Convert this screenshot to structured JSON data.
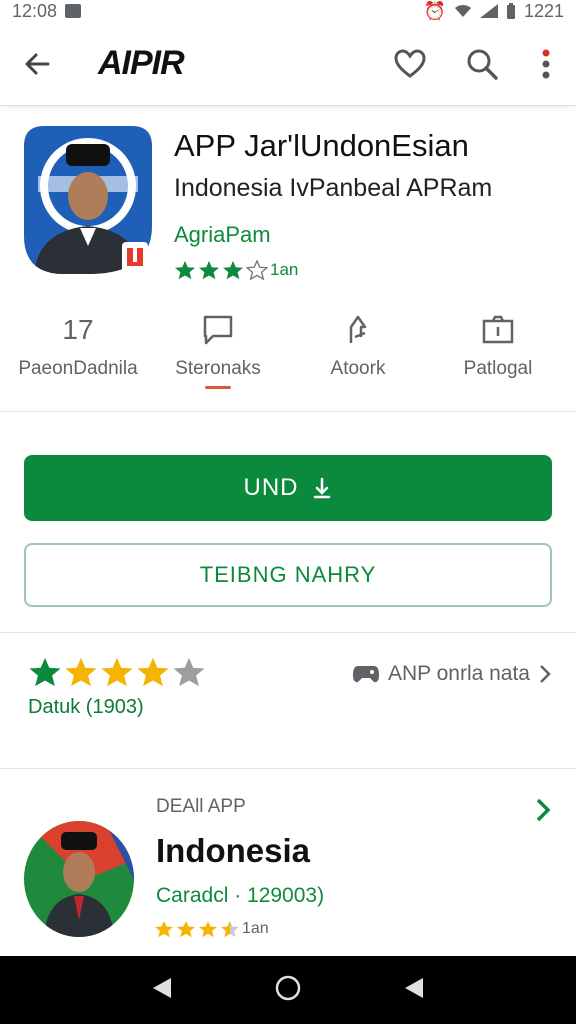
{
  "status_bar": {
    "time": "12:08",
    "battery_text": "1221"
  },
  "topbar": {
    "brand": "AIPIR",
    "back_icon": "arrow-left-icon",
    "actions": [
      "heart-icon",
      "search-icon",
      "more-vert-icon"
    ]
  },
  "app": {
    "title": "APP Jar'lUndonEsian",
    "subtitle": "Indonesia IvPanbeal APRam",
    "developer": "AgriaPam",
    "rating_stars": 3.5,
    "rating_text": "1an",
    "badge_text": "U"
  },
  "stats": [
    {
      "value": "17",
      "icon": "",
      "label": "PaeonDadnila",
      "active": false
    },
    {
      "value": "",
      "icon": "chat-icon",
      "label": "Steronaks",
      "active": true
    },
    {
      "value": "",
      "icon": "share-icon",
      "label": "Atoork",
      "active": false
    },
    {
      "value": "",
      "icon": "info-icon",
      "label": "Patlogal",
      "active": false
    }
  ],
  "buttons": {
    "install": "UND",
    "install_icon": "download-icon",
    "secondary": "TEIBNG NAHRY"
  },
  "rating": {
    "stars": 4,
    "caption": "Datuk (1903)",
    "right_text": "ANP onrla nata",
    "right_icon": "gamepad-icon"
  },
  "related": {
    "kicker": "DEAll APP",
    "title": "Indonesia",
    "meta": "Caradcl · 129003)",
    "rating_stars": 3.5,
    "rating_text": "1an"
  },
  "colors": {
    "green": "#0b8a3d",
    "star_gold": "#f5b400",
    "accent_underline": "#e2553a"
  }
}
